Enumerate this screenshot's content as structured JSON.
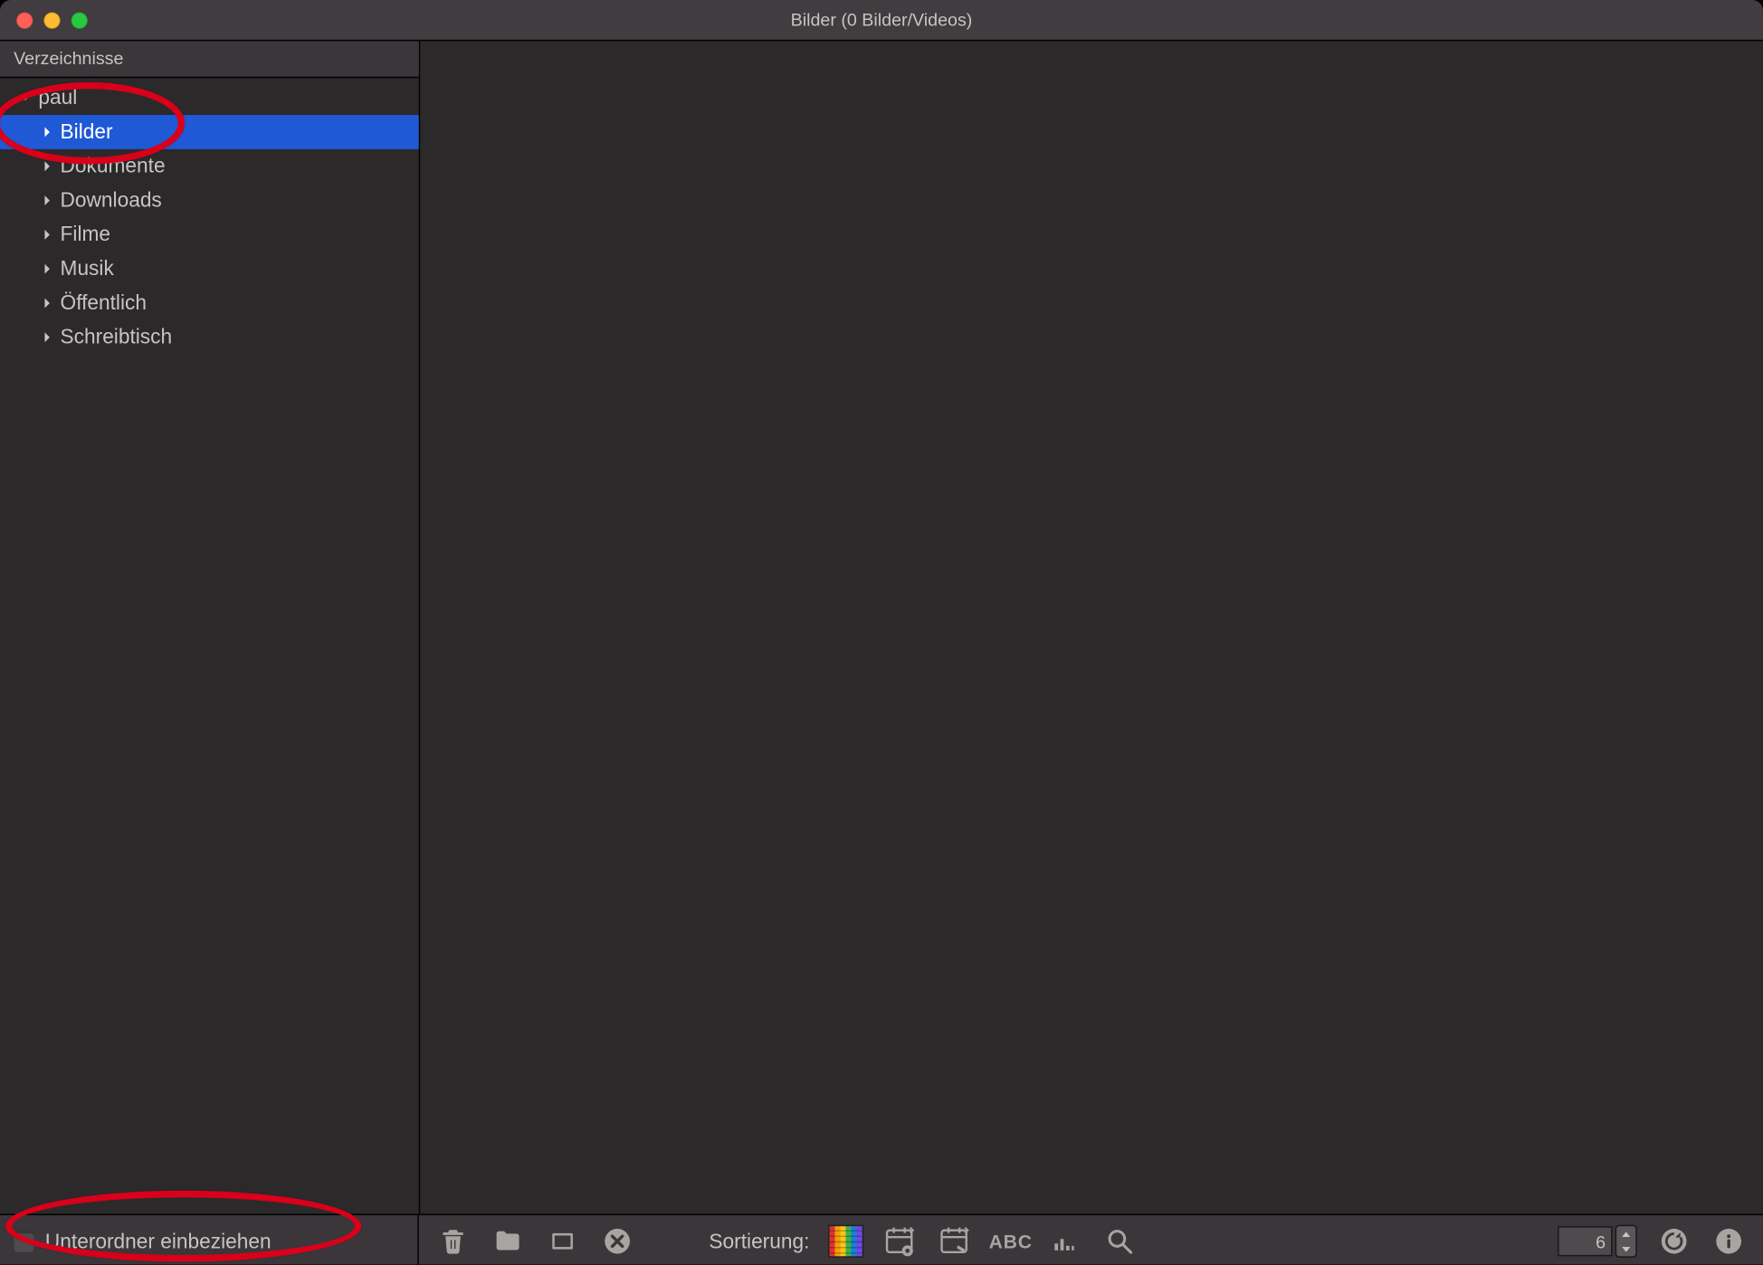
{
  "window": {
    "title": "Bilder (0 Bilder/Videos)"
  },
  "sidebar": {
    "header": "Verzeichnisse",
    "items": [
      {
        "label": "paul",
        "expanded": true,
        "indent": 0,
        "selected": false
      },
      {
        "label": "Bilder",
        "expanded": false,
        "indent": 1,
        "selected": true
      },
      {
        "label": "Dokumente",
        "expanded": false,
        "indent": 1,
        "selected": false
      },
      {
        "label": "Downloads",
        "expanded": false,
        "indent": 1,
        "selected": false
      },
      {
        "label": "Filme",
        "expanded": false,
        "indent": 1,
        "selected": false
      },
      {
        "label": "Musik",
        "expanded": false,
        "indent": 1,
        "selected": false
      },
      {
        "label": "Öffentlich",
        "expanded": false,
        "indent": 1,
        "selected": false
      },
      {
        "label": "Schreibtisch",
        "expanded": false,
        "indent": 1,
        "selected": false
      }
    ],
    "footer_checkbox_label": "Unterordner einbeziehen",
    "footer_checkbox_checked": false
  },
  "toolbar": {
    "sort_label": "Sortierung:",
    "thumb_size": "6"
  }
}
